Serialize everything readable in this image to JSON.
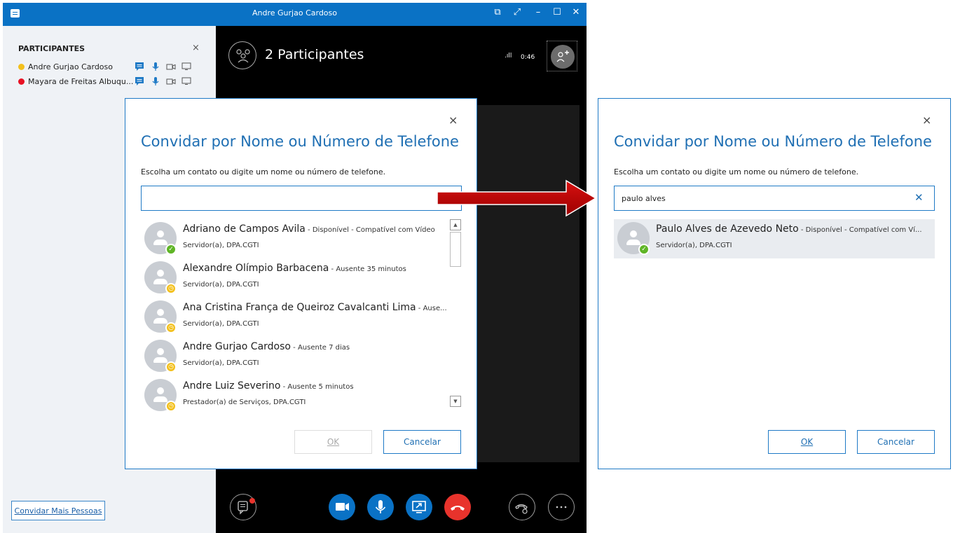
{
  "window": {
    "title": "Andre Gurjao Cardoso",
    "controls": [
      "⧉",
      "⤢",
      "–",
      "☐",
      "✕"
    ]
  },
  "sidebar": {
    "title": "PARTICIPANTES",
    "close": "×",
    "participants": [
      {
        "name": "Andre Gurjao Cardoso",
        "status_color": "#f3c01c"
      },
      {
        "name": "Mayara de Freitas Albuqu...",
        "status_color": "#e81123"
      }
    ],
    "invite_button": "Convidar Mais Pessoas"
  },
  "call": {
    "participants_label": "2 Participantes",
    "signal": ".ıll",
    "timer": "0:46"
  },
  "dialog_left": {
    "close": "×",
    "title": "Convidar por Nome ou Número de Telefone",
    "subtitle": "Escolha um contato ou digite um nome ou número de telefone.",
    "search_value": "",
    "contacts": [
      {
        "name": "Adriano de Campos Avila",
        "detail": " - Disponível - Compatível com Vídeo",
        "role": "Servidor(a), DPA.CGTI",
        "status": "available"
      },
      {
        "name": "Alexandre Olímpio Barbacena",
        "detail": " - Ausente 35 minutos",
        "role": "Servidor(a), DPA.CGTI",
        "status": "away"
      },
      {
        "name": "Ana Cristina França de Queiroz Cavalcanti Lima",
        "detail": " - Ause...",
        "role": "Servidor(a), DPA.CGTI",
        "status": "away"
      },
      {
        "name": "Andre Gurjao Cardoso",
        "detail": " - Ausente 7 dias",
        "role": "Servidor(a), DPA.CGTI",
        "status": "away"
      },
      {
        "name": "Andre Luiz Severino",
        "detail": " - Ausente 5 minutos",
        "role": "Prestador(a) de Serviços, DPA.CGTI",
        "status": "away"
      }
    ],
    "ok_label": "OK",
    "cancel_label": "Cancelar"
  },
  "dialog_right": {
    "close": "×",
    "title": "Convidar por Nome ou Número de Telefone",
    "subtitle": "Escolha um contato ou digite um nome ou número de telefone.",
    "search_value": "paulo alves",
    "clear": "✕",
    "contacts": [
      {
        "name": "Paulo Alves de Azevedo Neto",
        "detail": " - Disponível - Compatível com Ví...",
        "role": "Servidor(a), DPA.CGTI",
        "status": "available"
      }
    ],
    "ok_label": "OK",
    "cancel_label": "Cancelar"
  },
  "colors": {
    "accent": "#1f7ac6",
    "available": "#5fb526",
    "away": "#f3c01c",
    "hangup": "#e8332c",
    "arrow": "#c00000"
  }
}
